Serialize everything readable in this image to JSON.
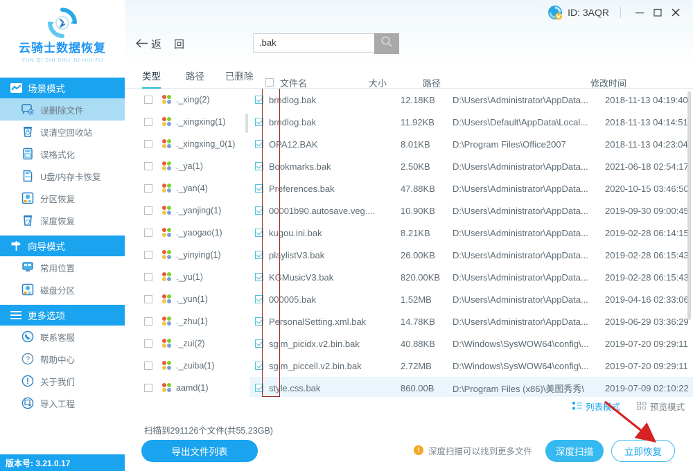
{
  "sidebar": {
    "logo": {
      "title": "云骑士数据恢复",
      "subtitle": "YUN QI SHI SHU JU HUI FU",
      "icon": "recovery-circle-icon"
    },
    "sections": [
      {
        "id": "scene-mode",
        "title": "场景模式",
        "icon": "scene-mode-icon",
        "items": [
          {
            "label": "误删除文件",
            "icon": "deleted-file-icon",
            "active": true
          },
          {
            "label": "误清空回收站",
            "icon": "recycle-bin-icon",
            "active": false
          },
          {
            "label": "误格式化",
            "icon": "format-icon",
            "active": false
          },
          {
            "label": "U盘/内存卡恢复",
            "icon": "usb-card-icon",
            "active": false
          },
          {
            "label": "分区恢复",
            "icon": "partition-recover-icon",
            "active": false
          },
          {
            "label": "深度恢复",
            "icon": "deep-recover-icon",
            "active": false
          }
        ]
      },
      {
        "id": "wizard-mode",
        "title": "向导模式",
        "icon": "signpost-icon",
        "items": [
          {
            "label": "常用位置",
            "icon": "common-location-icon",
            "active": false
          },
          {
            "label": "磁盘分区",
            "icon": "disk-partition-icon",
            "active": false
          }
        ]
      },
      {
        "id": "more-options",
        "title": "更多选项",
        "icon": "hamburger-icon",
        "items": [
          {
            "label": "联系客服",
            "icon": "phone-support-icon",
            "active": false
          },
          {
            "label": "帮助中心",
            "icon": "question-help-icon",
            "active": false
          },
          {
            "label": "关于我们",
            "icon": "info-about-icon",
            "active": false
          },
          {
            "label": "导入工程",
            "icon": "import-project-icon",
            "active": false
          }
        ]
      }
    ],
    "version": "版本号: 3.21.0.17"
  },
  "titlebar": {
    "user_id": "ID: 3AQR",
    "avatar_icon": "user-avatar-icon",
    "minimize": "—",
    "maximize": "□",
    "close": "✕"
  },
  "toolbar": {
    "back_arrow": "←",
    "back_label_1": "返",
    "back_label_2": "回",
    "search_value": ".bak",
    "search_placeholder": "",
    "search_icon": "search-icon"
  },
  "tabs": [
    {
      "label": "类型",
      "active": true
    },
    {
      "label": "路径",
      "active": false
    },
    {
      "label": "已删除",
      "active": false
    }
  ],
  "columns": {
    "select_all_checked": false,
    "filename": "文件名",
    "size": "大小",
    "path": "路径",
    "mtime": "修改时间"
  },
  "tree": [
    {
      "label": "._xing(2)",
      "checked": false
    },
    {
      "label": "._xingxing(1)",
      "checked": false
    },
    {
      "label": "._xingxing_0(1)",
      "checked": false
    },
    {
      "label": "._ya(1)",
      "checked": false
    },
    {
      "label": "._yan(4)",
      "checked": false
    },
    {
      "label": "._yanjing(1)",
      "checked": false
    },
    {
      "label": "._yaogao(1)",
      "checked": false
    },
    {
      "label": "._yinying(1)",
      "checked": false
    },
    {
      "label": "._yu(1)",
      "checked": false
    },
    {
      "label": "._yun(1)",
      "checked": false
    },
    {
      "label": "._zhu(1)",
      "checked": false
    },
    {
      "label": "._zui(2)",
      "checked": false
    },
    {
      "label": "._zuiba(1)",
      "checked": false
    },
    {
      "label": "aamd(1)",
      "checked": false
    }
  ],
  "files": [
    {
      "checked": true,
      "name": "brndlog.bak",
      "size": "12.18KB",
      "path": "D:\\Users\\Administrator\\AppData...",
      "mtime": "2018-11-13 04:19:40"
    },
    {
      "checked": true,
      "name": "brndlog.bak",
      "size": "11.92KB",
      "path": "D:\\Users\\Default\\AppData\\Local...",
      "mtime": "2018-11-13 04:14:51"
    },
    {
      "checked": true,
      "name": "OPA12.BAK",
      "size": "8.01KB",
      "path": "D:\\Program Files\\Office2007",
      "mtime": "2018-11-13 04:23:04"
    },
    {
      "checked": true,
      "name": "Bookmarks.bak",
      "size": "2.50KB",
      "path": "D:\\Users\\Administrator\\AppData...",
      "mtime": "2021-06-18 02:54:17"
    },
    {
      "checked": true,
      "name": "Preferences.bak",
      "size": "47.88KB",
      "path": "D:\\Users\\Administrator\\AppData...",
      "mtime": "2020-10-15 03:46:50"
    },
    {
      "checked": true,
      "name": "00001b90.autosave.veg....",
      "size": "10.90KB",
      "path": "D:\\Users\\Administrator\\AppData...",
      "mtime": "2019-09-30 09:00:45"
    },
    {
      "checked": true,
      "name": "kugou.ini.bak",
      "size": "8.21KB",
      "path": "D:\\Users\\Administrator\\AppData...",
      "mtime": "2019-02-28 06:14:15"
    },
    {
      "checked": true,
      "name": "playlistV3.bak",
      "size": "26.00KB",
      "path": "D:\\Users\\Administrator\\AppData...",
      "mtime": "2019-02-28 06:15:43"
    },
    {
      "checked": true,
      "name": "KGMusicV3.bak",
      "size": "820.00KB",
      "path": "D:\\Users\\Administrator\\AppData...",
      "mtime": "2019-02-28 06:15:43"
    },
    {
      "checked": true,
      "name": "000005.bak",
      "size": "1.52MB",
      "path": "D:\\Users\\Administrator\\AppData...",
      "mtime": "2019-04-16 02:33:06"
    },
    {
      "checked": true,
      "name": "PersonalSetting.xml.bak",
      "size": "14.78KB",
      "path": "D:\\Users\\Administrator\\AppData...",
      "mtime": "2019-06-29 03:36:29"
    },
    {
      "checked": true,
      "name": "sgim_picidx.v2.bin.bak",
      "size": "40.88KB",
      "path": "D:\\Windows\\SysWOW64\\config\\...",
      "mtime": "2019-07-20 09:29:11"
    },
    {
      "checked": true,
      "name": "sgim_piccell.v2.bin.bak",
      "size": "2.72MB",
      "path": "D:\\Windows\\SysWOW64\\config\\...",
      "mtime": "2019-07-20 09:29:11"
    },
    {
      "checked": true,
      "name": "style.css.bak",
      "size": "860.00B",
      "path": "D:\\Program Files (x86)\\美图秀秀\\",
      "mtime": "2019-07-09 02:10:22"
    }
  ],
  "viewmodes": [
    {
      "label": "列表模式",
      "icon": "list-view-icon",
      "active": true
    },
    {
      "label": "预览模式",
      "icon": "grid-preview-icon",
      "active": false
    }
  ],
  "bottom": {
    "scan_info": "扫描到291126个文件(共55.23GB)",
    "export_label": "导出文件列表",
    "hint_text": "深度扫描可以找到更多文件",
    "hint_icon": "warning-icon",
    "deep_scan_label": "深度扫描",
    "recover_label": "立即恢复"
  },
  "colors": {
    "brand_blue": "#1aa3ee",
    "accent_cyan": "#35b9f0",
    "annotation_red": "#d62222",
    "annotation_box": "#9c2b2b",
    "highlight_row": "#eaf6fb",
    "active_nav": "#aadcf4"
  }
}
